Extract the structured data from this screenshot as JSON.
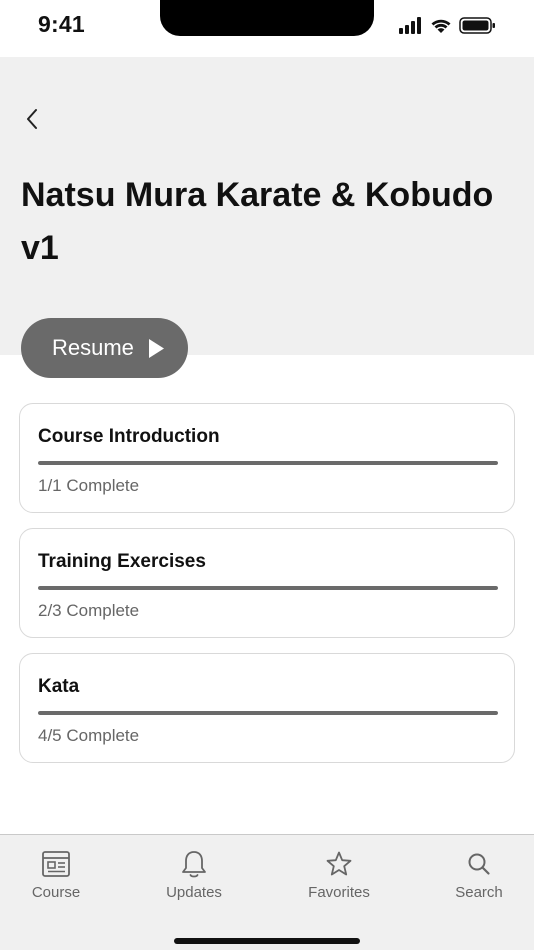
{
  "status_bar": {
    "time": "9:41"
  },
  "header": {
    "title": "Natsu Mura Karate & Kobudo v1",
    "background": "#f0f0f0"
  },
  "resume": {
    "label": "Resume",
    "color": "#6a6a6a"
  },
  "modules": [
    {
      "title": "Course Introduction",
      "status": "1/1 Complete",
      "progress": 1.0
    },
    {
      "title": "Training Exercises",
      "status": "2/3 Complete",
      "progress": 1.0
    },
    {
      "title": "Kata",
      "status": "4/5 Complete",
      "progress": 1.0
    }
  ],
  "tab_bar": {
    "tabs": [
      {
        "label": "Course",
        "icon": "course-icon"
      },
      {
        "label": "Updates",
        "icon": "bell-icon"
      },
      {
        "label": "Favorites",
        "icon": "star-icon"
      },
      {
        "label": "Search",
        "icon": "search-icon"
      }
    ]
  }
}
